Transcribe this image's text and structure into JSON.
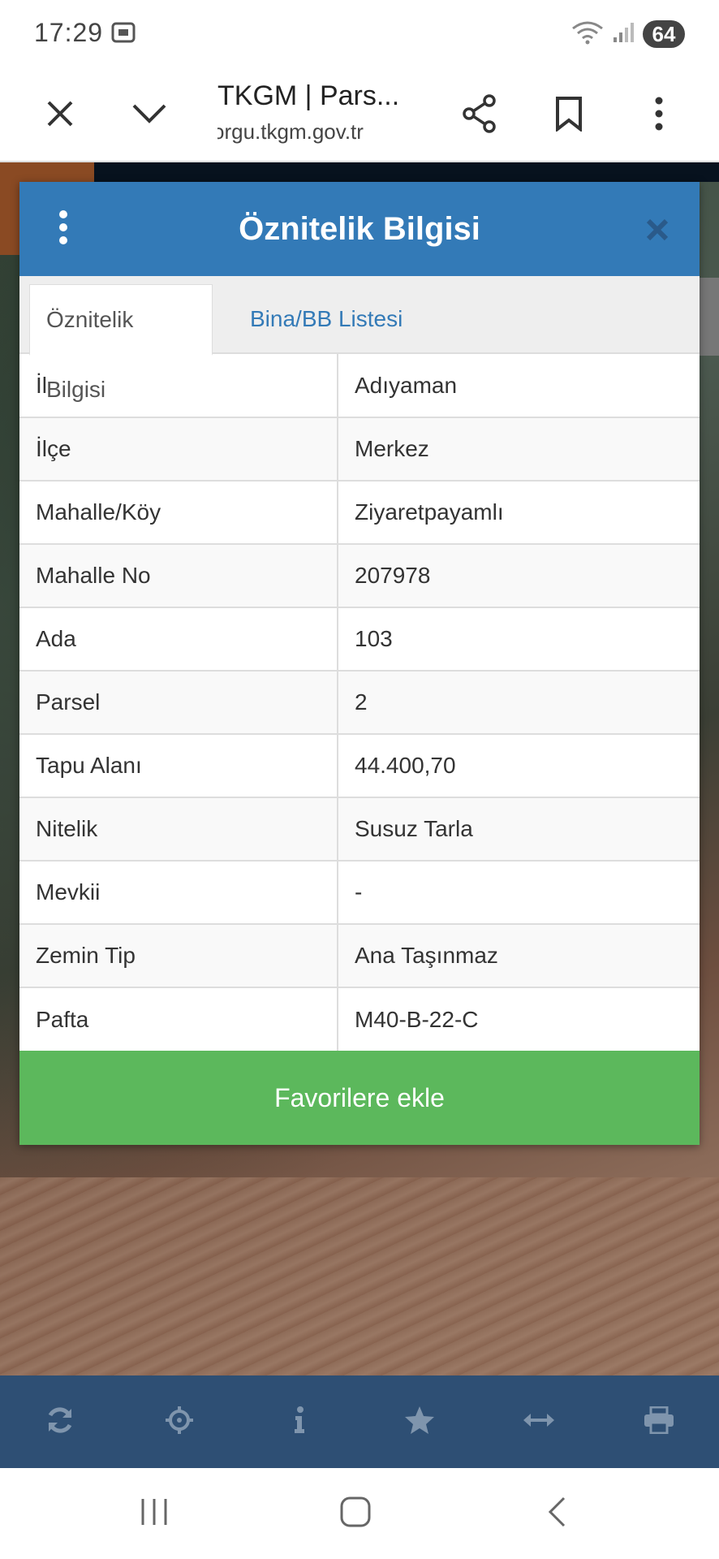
{
  "status_bar": {
    "time": "17:29",
    "battery": "64"
  },
  "browser": {
    "title": "TKGM | Pars...",
    "url": "orgu.tkgm.gov.tr"
  },
  "modal": {
    "title": "Öznitelik Bilgisi",
    "tabs": [
      {
        "label": "Öznitelik Bilgisi",
        "active": true
      },
      {
        "label": "Bina/BB Listesi",
        "active": false
      }
    ],
    "rows": [
      {
        "key": "İl",
        "value": "Adıyaman"
      },
      {
        "key": "İlçe",
        "value": "Merkez"
      },
      {
        "key": "Mahalle/Köy",
        "value": "Ziyaretpayamlı"
      },
      {
        "key": "Mahalle No",
        "value": "207978"
      },
      {
        "key": "Ada",
        "value": "103"
      },
      {
        "key": "Parsel",
        "value": "2"
      },
      {
        "key": "Tapu Alanı",
        "value": "44.400,70"
      },
      {
        "key": "Nitelik",
        "value": "Susuz Tarla"
      },
      {
        "key": "Mevkii",
        "value": "-"
      },
      {
        "key": "Zemin Tip",
        "value": "Ana Taşınmaz"
      },
      {
        "key": "Pafta",
        "value": "M40-B-22-C"
      }
    ],
    "favorite_button": "Favorilere ekle"
  },
  "map_toolbar": {
    "icons": [
      "refresh-icon",
      "crosshair-icon",
      "info-icon",
      "star-icon",
      "measure-icon",
      "print-icon"
    ]
  },
  "colors": {
    "header": "#337ab7",
    "favorite": "#5cb85c",
    "map_toolbar": "#2e4f74"
  }
}
